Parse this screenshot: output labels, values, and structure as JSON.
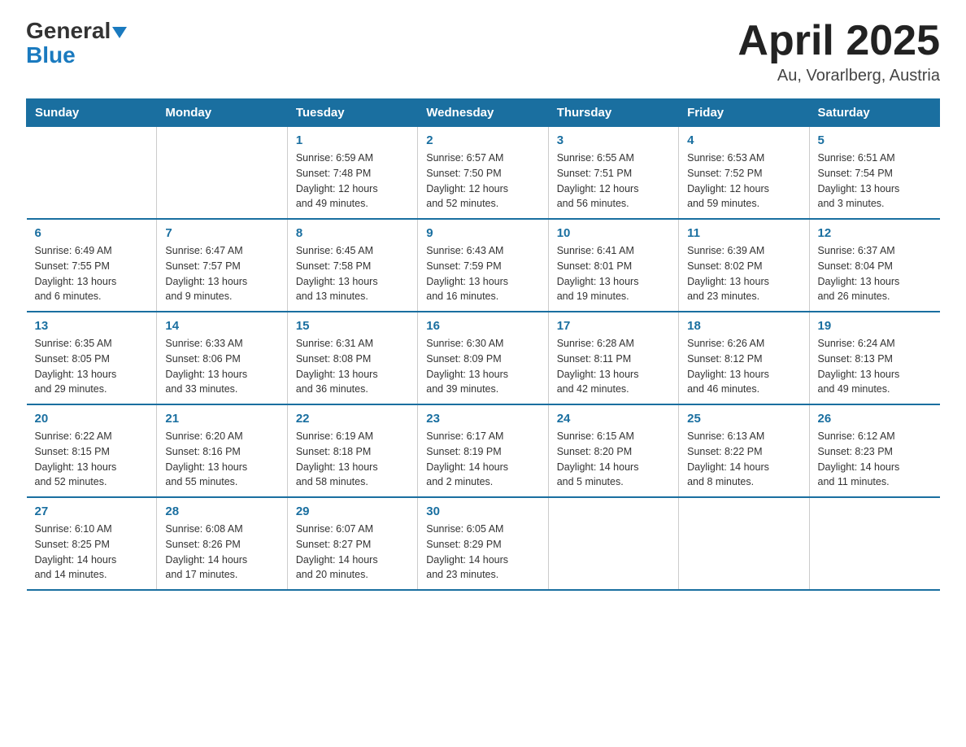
{
  "header": {
    "logo_general": "General",
    "logo_blue": "Blue",
    "month_title": "April 2025",
    "location": "Au, Vorarlberg, Austria"
  },
  "days_header": [
    "Sunday",
    "Monday",
    "Tuesday",
    "Wednesday",
    "Thursday",
    "Friday",
    "Saturday"
  ],
  "weeks": [
    [
      {
        "day": "",
        "info": ""
      },
      {
        "day": "",
        "info": ""
      },
      {
        "day": "1",
        "info": "Sunrise: 6:59 AM\nSunset: 7:48 PM\nDaylight: 12 hours\nand 49 minutes."
      },
      {
        "day": "2",
        "info": "Sunrise: 6:57 AM\nSunset: 7:50 PM\nDaylight: 12 hours\nand 52 minutes."
      },
      {
        "day": "3",
        "info": "Sunrise: 6:55 AM\nSunset: 7:51 PM\nDaylight: 12 hours\nand 56 minutes."
      },
      {
        "day": "4",
        "info": "Sunrise: 6:53 AM\nSunset: 7:52 PM\nDaylight: 12 hours\nand 59 minutes."
      },
      {
        "day": "5",
        "info": "Sunrise: 6:51 AM\nSunset: 7:54 PM\nDaylight: 13 hours\nand 3 minutes."
      }
    ],
    [
      {
        "day": "6",
        "info": "Sunrise: 6:49 AM\nSunset: 7:55 PM\nDaylight: 13 hours\nand 6 minutes."
      },
      {
        "day": "7",
        "info": "Sunrise: 6:47 AM\nSunset: 7:57 PM\nDaylight: 13 hours\nand 9 minutes."
      },
      {
        "day": "8",
        "info": "Sunrise: 6:45 AM\nSunset: 7:58 PM\nDaylight: 13 hours\nand 13 minutes."
      },
      {
        "day": "9",
        "info": "Sunrise: 6:43 AM\nSunset: 7:59 PM\nDaylight: 13 hours\nand 16 minutes."
      },
      {
        "day": "10",
        "info": "Sunrise: 6:41 AM\nSunset: 8:01 PM\nDaylight: 13 hours\nand 19 minutes."
      },
      {
        "day": "11",
        "info": "Sunrise: 6:39 AM\nSunset: 8:02 PM\nDaylight: 13 hours\nand 23 minutes."
      },
      {
        "day": "12",
        "info": "Sunrise: 6:37 AM\nSunset: 8:04 PM\nDaylight: 13 hours\nand 26 minutes."
      }
    ],
    [
      {
        "day": "13",
        "info": "Sunrise: 6:35 AM\nSunset: 8:05 PM\nDaylight: 13 hours\nand 29 minutes."
      },
      {
        "day": "14",
        "info": "Sunrise: 6:33 AM\nSunset: 8:06 PM\nDaylight: 13 hours\nand 33 minutes."
      },
      {
        "day": "15",
        "info": "Sunrise: 6:31 AM\nSunset: 8:08 PM\nDaylight: 13 hours\nand 36 minutes."
      },
      {
        "day": "16",
        "info": "Sunrise: 6:30 AM\nSunset: 8:09 PM\nDaylight: 13 hours\nand 39 minutes."
      },
      {
        "day": "17",
        "info": "Sunrise: 6:28 AM\nSunset: 8:11 PM\nDaylight: 13 hours\nand 42 minutes."
      },
      {
        "day": "18",
        "info": "Sunrise: 6:26 AM\nSunset: 8:12 PM\nDaylight: 13 hours\nand 46 minutes."
      },
      {
        "day": "19",
        "info": "Sunrise: 6:24 AM\nSunset: 8:13 PM\nDaylight: 13 hours\nand 49 minutes."
      }
    ],
    [
      {
        "day": "20",
        "info": "Sunrise: 6:22 AM\nSunset: 8:15 PM\nDaylight: 13 hours\nand 52 minutes."
      },
      {
        "day": "21",
        "info": "Sunrise: 6:20 AM\nSunset: 8:16 PM\nDaylight: 13 hours\nand 55 minutes."
      },
      {
        "day": "22",
        "info": "Sunrise: 6:19 AM\nSunset: 8:18 PM\nDaylight: 13 hours\nand 58 minutes."
      },
      {
        "day": "23",
        "info": "Sunrise: 6:17 AM\nSunset: 8:19 PM\nDaylight: 14 hours\nand 2 minutes."
      },
      {
        "day": "24",
        "info": "Sunrise: 6:15 AM\nSunset: 8:20 PM\nDaylight: 14 hours\nand 5 minutes."
      },
      {
        "day": "25",
        "info": "Sunrise: 6:13 AM\nSunset: 8:22 PM\nDaylight: 14 hours\nand 8 minutes."
      },
      {
        "day": "26",
        "info": "Sunrise: 6:12 AM\nSunset: 8:23 PM\nDaylight: 14 hours\nand 11 minutes."
      }
    ],
    [
      {
        "day": "27",
        "info": "Sunrise: 6:10 AM\nSunset: 8:25 PM\nDaylight: 14 hours\nand 14 minutes."
      },
      {
        "day": "28",
        "info": "Sunrise: 6:08 AM\nSunset: 8:26 PM\nDaylight: 14 hours\nand 17 minutes."
      },
      {
        "day": "29",
        "info": "Sunrise: 6:07 AM\nSunset: 8:27 PM\nDaylight: 14 hours\nand 20 minutes."
      },
      {
        "day": "30",
        "info": "Sunrise: 6:05 AM\nSunset: 8:29 PM\nDaylight: 14 hours\nand 23 minutes."
      },
      {
        "day": "",
        "info": ""
      },
      {
        "day": "",
        "info": ""
      },
      {
        "day": "",
        "info": ""
      }
    ]
  ]
}
